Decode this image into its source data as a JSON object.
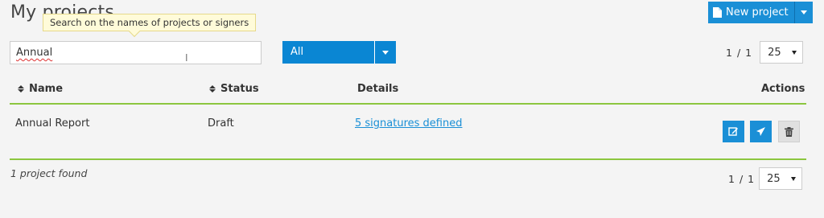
{
  "page": {
    "title": "My projects"
  },
  "tooltip": {
    "text": "Search on the names of projects or signers"
  },
  "new_project": {
    "label": "New project",
    "icon": "document-icon"
  },
  "search": {
    "value": "Annual"
  },
  "filter": {
    "selected": "All"
  },
  "pager_top": {
    "current": "1",
    "separator": "/",
    "total": "1",
    "page_size": "25"
  },
  "table": {
    "columns": {
      "name": "Name",
      "status": "Status",
      "details": "Details",
      "actions": "Actions"
    },
    "rows": [
      {
        "name": "Annual Report",
        "status": "Draft",
        "details": "5 signatures defined"
      }
    ]
  },
  "footer": {
    "found": "1 project found"
  },
  "pager_bottom": {
    "current": "1",
    "separator": "/",
    "total": "1",
    "page_size": "25"
  },
  "colors": {
    "accent": "#1a8fd6",
    "rule": "#8cc63f",
    "tooltip_bg": "#fffbd9"
  }
}
